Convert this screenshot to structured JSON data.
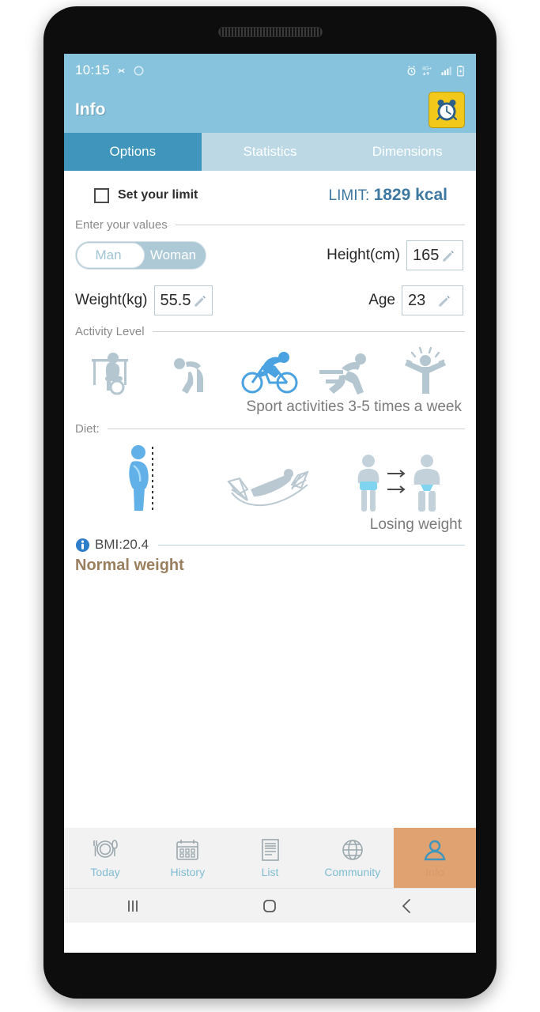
{
  "status_bar": {
    "time": "10:15",
    "icons_left": [
      "sync-pinwheel-icon",
      "circle-icon"
    ],
    "icons_right": [
      "alarm-icon",
      "4g-plus-icon",
      "signal-bars-icon",
      "battery-icon"
    ],
    "network": "4G+",
    "background": "#87c3dd"
  },
  "app_bar": {
    "title": "Info",
    "alarm_button": "alarm-clock-button",
    "alarm_bg": "#f2c81b"
  },
  "tabs": [
    {
      "label": "Options",
      "active": true
    },
    {
      "label": "Statistics",
      "active": false
    },
    {
      "label": "Dimensions",
      "active": false
    }
  ],
  "limit": {
    "checkbox_label": "Set your limit",
    "checked": false,
    "value_prefix": "LIMIT:",
    "value": "1829 kcal",
    "value_color": "#3c78a0"
  },
  "values_section": {
    "header": "Enter your values",
    "gender": {
      "options": [
        "Man",
        "Woman"
      ],
      "selected": "Man"
    },
    "height": {
      "label": "Height(cm)",
      "value": "165"
    },
    "weight": {
      "label": "Weight(kg)",
      "value": "55.5"
    },
    "age": {
      "label": "Age",
      "value": "23"
    }
  },
  "activity": {
    "header": "Activity Level",
    "icons": [
      "desk-sitting-icon",
      "standing-light-icon",
      "cycling-icon",
      "running-icon",
      "celebrating-athlete-icon"
    ],
    "selected_index": 2,
    "selected_color": "#4aa3e0",
    "caption": "Sport activities 3-5 times a week"
  },
  "diet": {
    "header": "Diet:",
    "icons": [
      "gaining-weight-figure-icon",
      "hammock-rest-icon",
      "losing-weight-figures-icon"
    ],
    "selected_index": 2,
    "caption": "Losing weight"
  },
  "bmi": {
    "info_icon": "info-icon",
    "label": "BMI:20.4",
    "status": "Normal weight",
    "status_color": "#9a7f5f"
  },
  "bottom_nav": [
    {
      "label": "Today",
      "icon": "plate-cutlery-icon",
      "active": false
    },
    {
      "label": "History",
      "icon": "calendar-icon",
      "active": false
    },
    {
      "label": "List",
      "icon": "document-list-icon",
      "active": false
    },
    {
      "label": "Community",
      "icon": "globe-icon",
      "active": false
    },
    {
      "label": "Info",
      "icon": "person-icon",
      "active": true
    }
  ],
  "system_nav": [
    {
      "name": "recents-button",
      "glyph": "|||"
    },
    {
      "name": "home-button",
      "glyph": ""
    },
    {
      "name": "back-button",
      "glyph": ""
    }
  ]
}
